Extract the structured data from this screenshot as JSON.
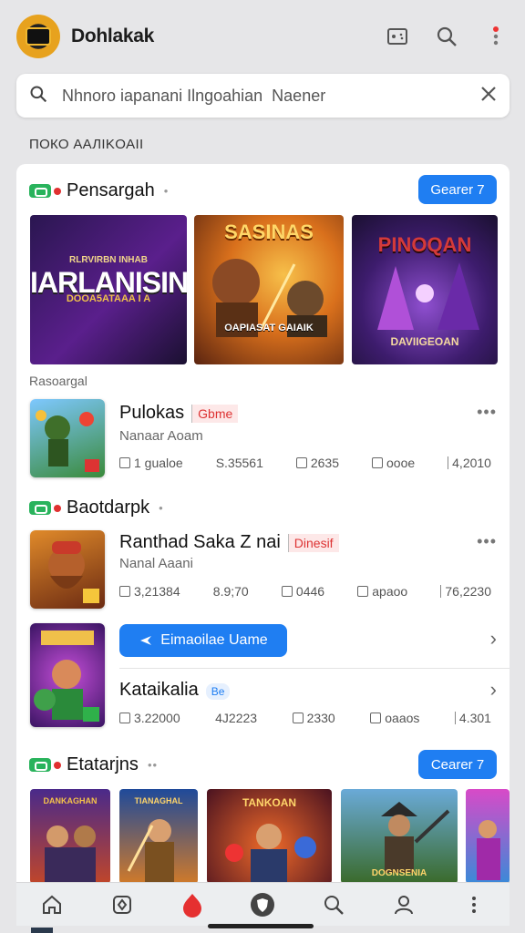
{
  "header": {
    "app_title": "Dohlakak"
  },
  "search": {
    "placeholder": "Nhnoro iapanani Ilngoahian  Naener"
  },
  "section_caption": "ПОКО ААЛIKОAII",
  "featured": {
    "title": "Pensargah",
    "button": "Gearer 7",
    "banners": [
      {
        "text": "IARLANISIN",
        "subtext": "RLRVIRBN INHAB",
        "caption": "DOOA5ATAAA I A"
      },
      {
        "text": "SASINAS",
        "caption": "OAPIASAT GAIAIK"
      },
      {
        "text": "PINOQAN",
        "caption": "DAVIIGEOAN"
      }
    ],
    "sub_caption": "Rasoargal"
  },
  "game_1": {
    "title": "Pulokas",
    "tag": "Gbme",
    "subtitle": "Nanaar Aoam",
    "stats": [
      "1 gualoe",
      "S.35561",
      "2635",
      "oooe",
      "4,2010"
    ]
  },
  "section_2": {
    "title": "Baotdarpk"
  },
  "game_2": {
    "title": "Ranthad Saka Z nai",
    "tag": "Dinesif",
    "subtitle": "Nanal Aaani",
    "stats": [
      "3,21384",
      "8.9;70",
      "0446",
      "apaoo",
      "76,2230"
    ]
  },
  "game_3": {
    "button": "Eimaoilae Uame",
    "title": "Kataikalia",
    "tag": "Be",
    "stats": [
      "3.22000",
      "4J2223",
      "2330",
      "oaaos",
      "4.301"
    ]
  },
  "section_3": {
    "title": "Etatarjns",
    "button": "Cearer 7",
    "thumbs": [
      {
        "text": "DANKAGHAN"
      },
      {
        "text": "TIANAGHAL"
      },
      {
        "text": "TANKOAN"
      },
      {
        "text": "DOGNSENIA"
      },
      {
        "text": ""
      }
    ]
  },
  "colors": {
    "accent": "#1f7ef2",
    "green_badge": "#29b35c",
    "red_dot": "#e03030"
  },
  "icons": [
    "gamepad-icon",
    "search-icon",
    "more-vertical-icon",
    "close-icon",
    "home-icon",
    "apps-icon",
    "fire-icon",
    "shield-icon",
    "search-nav-icon",
    "profile-icon",
    "menu-icon"
  ]
}
